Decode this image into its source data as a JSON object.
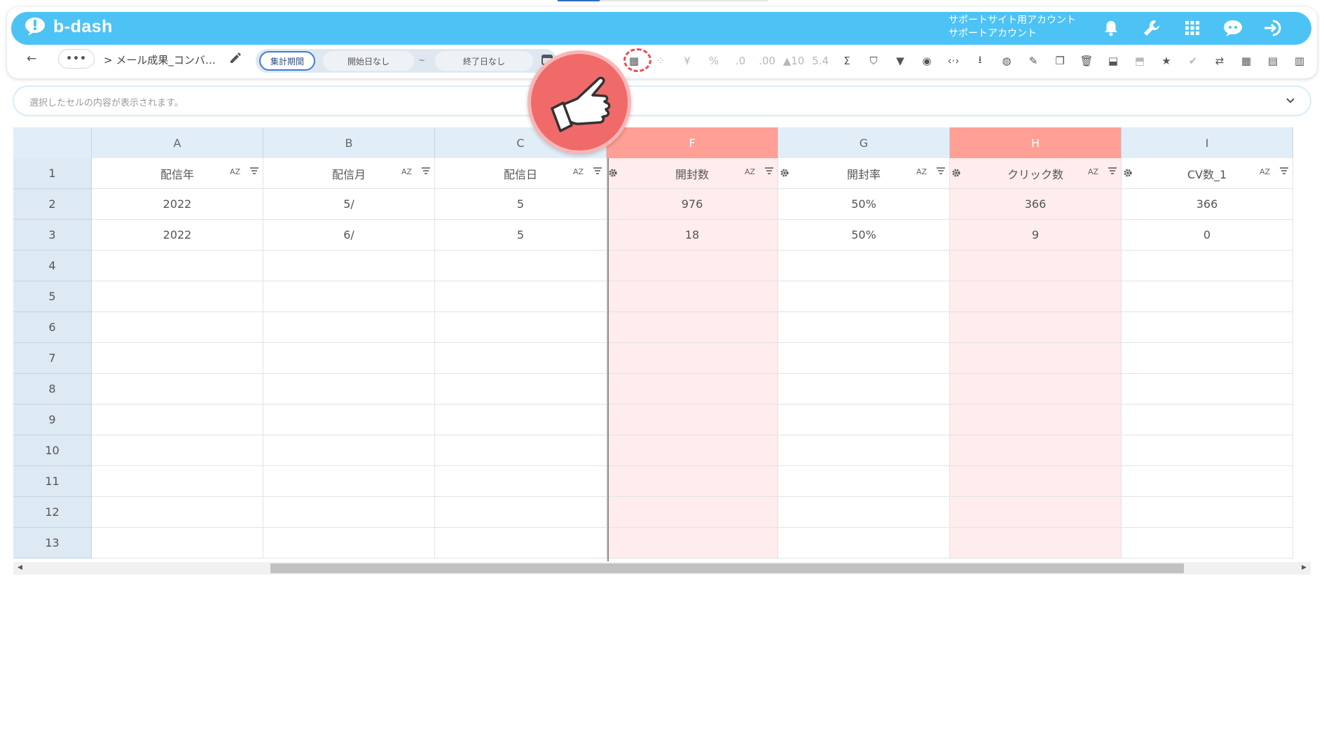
{
  "app": {
    "logo_text": "b-dash",
    "account_line1": "サポートサイト用アカウント",
    "account_line2": "サポートアカウント"
  },
  "header_icons": [
    "bell-icon",
    "wrench-icon",
    "apps-grid-icon",
    "mascot-icon",
    "logout-icon"
  ],
  "toolbar": {
    "back_label": "←",
    "more_label": "•••",
    "breadcrumb": "> メール成果_コンバ…",
    "period_label": "集計期間",
    "start_date": "開始日なし",
    "tilde": "~",
    "end_date": "終了日なし",
    "tools": [
      {
        "name": "table-layout-icon",
        "glyph": "▦",
        "muted": false
      },
      {
        "name": "loading-icon",
        "glyph": "⁘",
        "muted": true
      },
      {
        "name": "yen-icon",
        "glyph": "¥",
        "muted": true
      },
      {
        "name": "percent-icon",
        "glyph": "%",
        "muted": true
      },
      {
        "name": "decimal-decrease-icon",
        "glyph": ".0",
        "muted": true
      },
      {
        "name": "decimal-increase-icon",
        "glyph": ".00",
        "muted": true
      },
      {
        "name": "scale-up-icon",
        "glyph": "▲10",
        "muted": true
      },
      {
        "name": "scale-down-icon",
        "glyph": "5.4",
        "muted": true
      },
      {
        "name": "sum-icon",
        "glyph": "Σ",
        "muted": false
      },
      {
        "name": "filter-clear-icon",
        "glyph": "⛉",
        "muted": false
      },
      {
        "name": "filter-icon",
        "glyph": "▼",
        "muted": false
      },
      {
        "name": "eye-icon",
        "glyph": "◉",
        "muted": false
      },
      {
        "name": "code-icon",
        "glyph": "‹·›",
        "muted": false
      },
      {
        "name": "download-icon",
        "glyph": "⭳",
        "muted": false
      },
      {
        "name": "chart-icon",
        "glyph": "◍",
        "muted": false
      },
      {
        "name": "edit-icon",
        "glyph": "✎",
        "muted": false
      },
      {
        "name": "copy-icon",
        "glyph": "❐",
        "muted": false
      },
      {
        "name": "trash-icon",
        "glyph": "🗑",
        "muted": false
      },
      {
        "name": "archive-icon",
        "glyph": "⬓",
        "muted": false
      },
      {
        "name": "unarchive-icon",
        "glyph": "⬒",
        "muted": true
      },
      {
        "name": "star-icon",
        "glyph": "★",
        "muted": false
      },
      {
        "name": "user-check-icon",
        "glyph": "✔",
        "muted": true
      },
      {
        "name": "repeat-icon",
        "glyph": "⇄",
        "muted": false
      },
      {
        "name": "calendar-icon",
        "glyph": "▦",
        "muted": false
      },
      {
        "name": "document-icon",
        "glyph": "▤",
        "muted": false
      },
      {
        "name": "clipboard-icon",
        "glyph": "▥",
        "muted": false
      }
    ]
  },
  "formula_bar": {
    "placeholder": "選択したセルの内容が表示されます。"
  },
  "grid": {
    "columns": [
      {
        "letter": "A",
        "header": "配信年",
        "highlight": false
      },
      {
        "letter": "B",
        "header": "配信月",
        "highlight": false
      },
      {
        "letter": "C",
        "header": "配信日",
        "highlight": false
      },
      {
        "letter": "F",
        "header": "開封数",
        "highlight": true
      },
      {
        "letter": "G",
        "header": "開封率",
        "highlight": false
      },
      {
        "letter": "H",
        "header": "クリック数",
        "highlight": true
      },
      {
        "letter": "I",
        "header": "CV数_1",
        "highlight": false
      }
    ],
    "sort_label": "AZ",
    "rows": [
      [
        "2022",
        "5/",
        "5",
        "976",
        "50%",
        "366",
        "366"
      ],
      [
        "2022",
        "6/",
        "5",
        "18",
        "50%",
        "9",
        "0"
      ]
    ],
    "row_numbers": [
      "1",
      "2",
      "3",
      "4",
      "5",
      "6",
      "7",
      "8",
      "9",
      "10",
      "11",
      "12",
      "13"
    ]
  },
  "colors": {
    "brand": "#4dc3f5",
    "highlight_header": "#ff9f95",
    "highlight_cell": "#ffecec",
    "pointer": "#f06a6a"
  }
}
